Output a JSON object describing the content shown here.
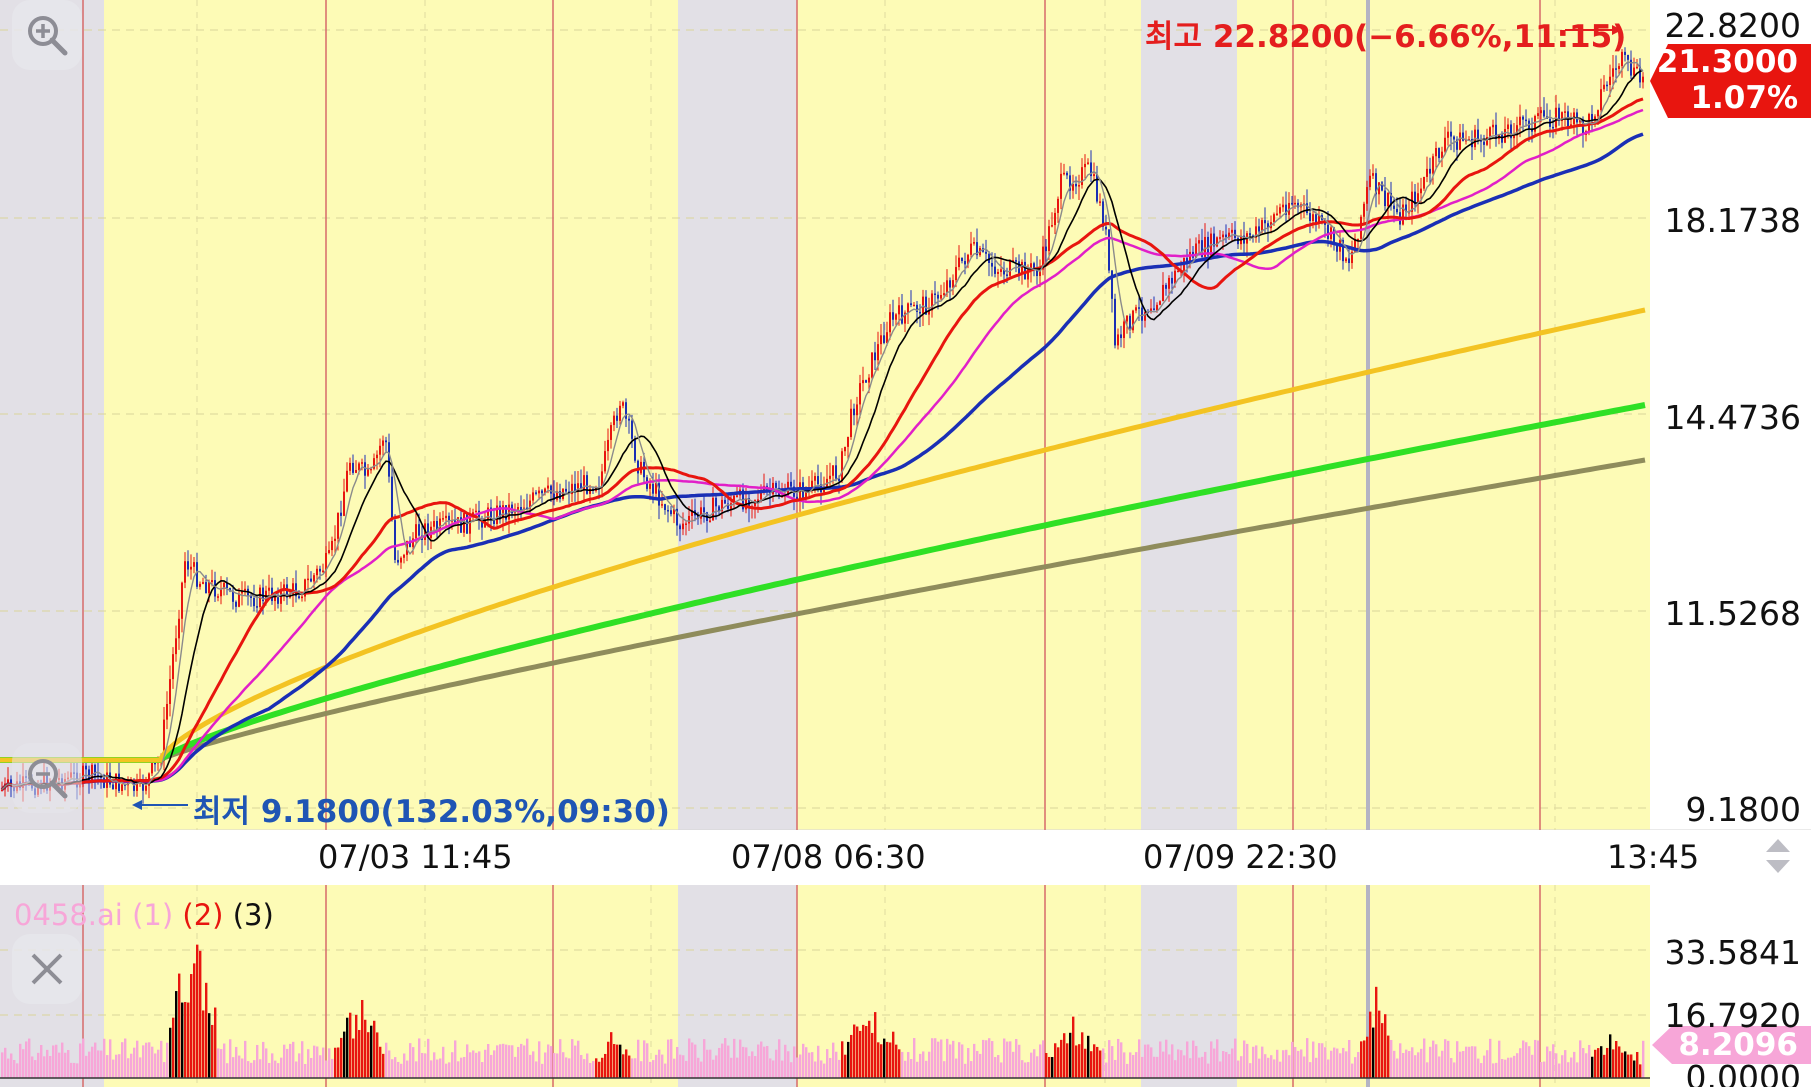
{
  "price_axis": {
    "labels": [
      "22.8200",
      "18.1738",
      "14.4736",
      "11.5268",
      "9.1800"
    ]
  },
  "time_axis": {
    "labels": [
      "07/03 11:45",
      "07/08 06:30",
      "07/09 22:30",
      "13:45"
    ]
  },
  "current_price": {
    "price": "21.3000",
    "change": "1.07%",
    "color": "#e8150f"
  },
  "high_marker": {
    "text": "최고 22.8200(−6.66%,11:15)",
    "color": "#e41e1e"
  },
  "low_marker": {
    "text": "최저 9.1800(132.03%,09:30)",
    "color": "#1f55b4"
  },
  "indicator_legend": {
    "name": "0458.ai",
    "p1": "(1)",
    "p2": "(2)",
    "p3": "(3)"
  },
  "indicator_axis": {
    "labels": [
      "33.5841",
      "16.7920",
      "0.0000"
    ],
    "current": "8.2096",
    "current_color": "#f7a6d8"
  },
  "icons": {
    "zoom_in": "zoom-in-icon",
    "zoom_out": "zoom-out-icon",
    "close": "close-icon",
    "scroll": "scroll-arrows-icon"
  },
  "colors": {
    "session_bg": "#fdfbb6",
    "offhours_bg": "#e2e0e6",
    "ma_colors": [
      "#8b8b8b",
      "#000000",
      "#e8150f",
      "#e11fc8",
      "#1a2fb5",
      "#f3c322",
      "#2fe025",
      "#8f8c5c"
    ]
  }
}
